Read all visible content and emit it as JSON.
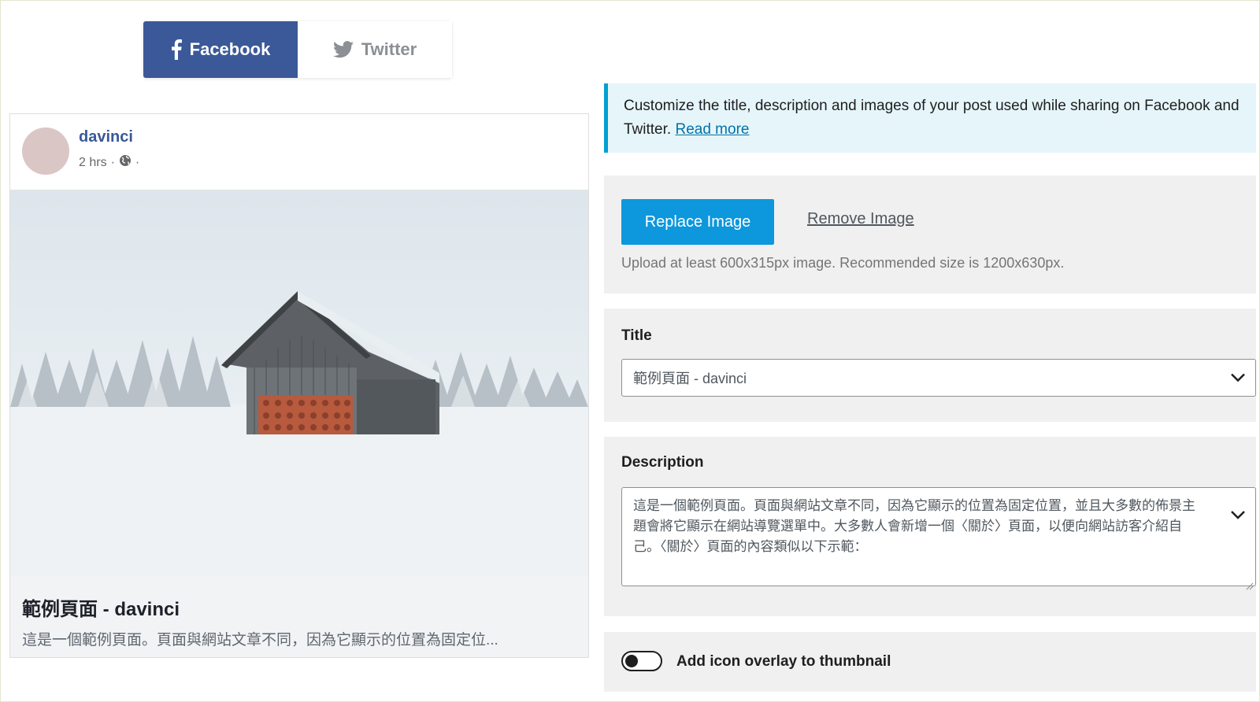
{
  "tabs": [
    {
      "label": "Facebook",
      "icon": "facebook-icon",
      "active": true
    },
    {
      "label": "Twitter",
      "icon": "twitter-icon",
      "active": false
    }
  ],
  "colors": {
    "facebook_blue": "#3b5998",
    "primary_button": "#0d97dc",
    "notice_bg": "#e5f5fa",
    "notice_border": "#00a0d2"
  },
  "preview": {
    "author": "davinci",
    "time": "2 hrs",
    "separator": "·",
    "privacy_icon": "globe-icon",
    "post_title": "範例頁面 - davinci",
    "post_description": "這是一個範例頁面。頁面與網站文章不同，因為它顯示的位置為固定位..."
  },
  "notice": {
    "text": "Customize the title, description and images of your post used while sharing on Facebook and Twitter.",
    "link": "Read more"
  },
  "image_panel": {
    "replace_label": "Replace Image",
    "remove_label": "Remove Image",
    "hint": "Upload at least 600x315px image. Recommended size is 1200x630px."
  },
  "title_field": {
    "label": "Title",
    "value": "範例頁面 - davinci"
  },
  "description_field": {
    "label": "Description",
    "value": "這是一個範例頁面。頁面與網站文章不同，因為它顯示的位置為固定位置，並且大多數的佈景主題會將它顯示在網站導覽選單中。大多數人會新增一個〈關於〉頁面，以便向網站訪客介紹自己。〈關於〉頁面的內容類似以下示範："
  },
  "overlay_toggle": {
    "label": "Add icon overlay to thumbnail",
    "enabled": false
  }
}
